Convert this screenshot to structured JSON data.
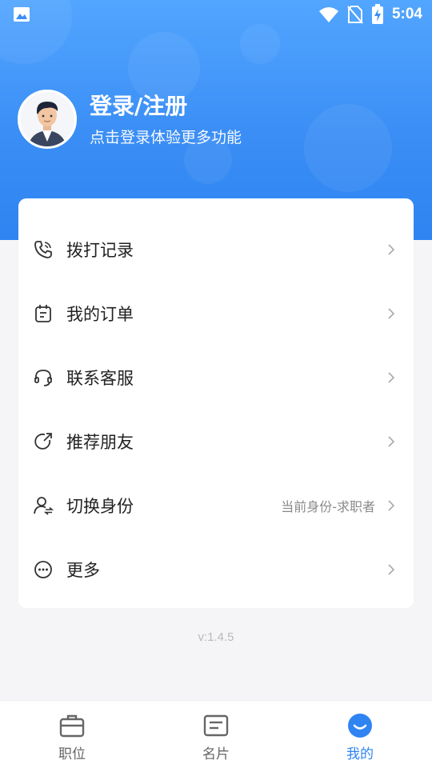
{
  "status_bar": {
    "time": "5:04"
  },
  "profile": {
    "title": "登录/注册",
    "subtitle": "点击登录体验更多功能"
  },
  "menu": [
    {
      "label": "拨打记录",
      "icon": "phone-icon",
      "extra": ""
    },
    {
      "label": "我的订单",
      "icon": "order-icon",
      "extra": ""
    },
    {
      "label": "联系客服",
      "icon": "headset-icon",
      "extra": ""
    },
    {
      "label": "推荐朋友",
      "icon": "share-icon",
      "extra": ""
    },
    {
      "label": "切换身份",
      "icon": "switch-user-icon",
      "extra": "当前身份-求职者"
    },
    {
      "label": "更多",
      "icon": "more-icon",
      "extra": ""
    }
  ],
  "version": "v:1.4.5",
  "tabs": [
    {
      "label": "职位",
      "icon": "briefcase-icon",
      "active": false
    },
    {
      "label": "名片",
      "icon": "card-icon",
      "active": false
    },
    {
      "label": "我的",
      "icon": "smile-icon",
      "active": true
    }
  ],
  "colors": {
    "primary": "#2f84f2",
    "header_top": "#52a6ff",
    "background": "#f5f5f7",
    "text": "#222222",
    "muted": "#8a8a8a"
  }
}
